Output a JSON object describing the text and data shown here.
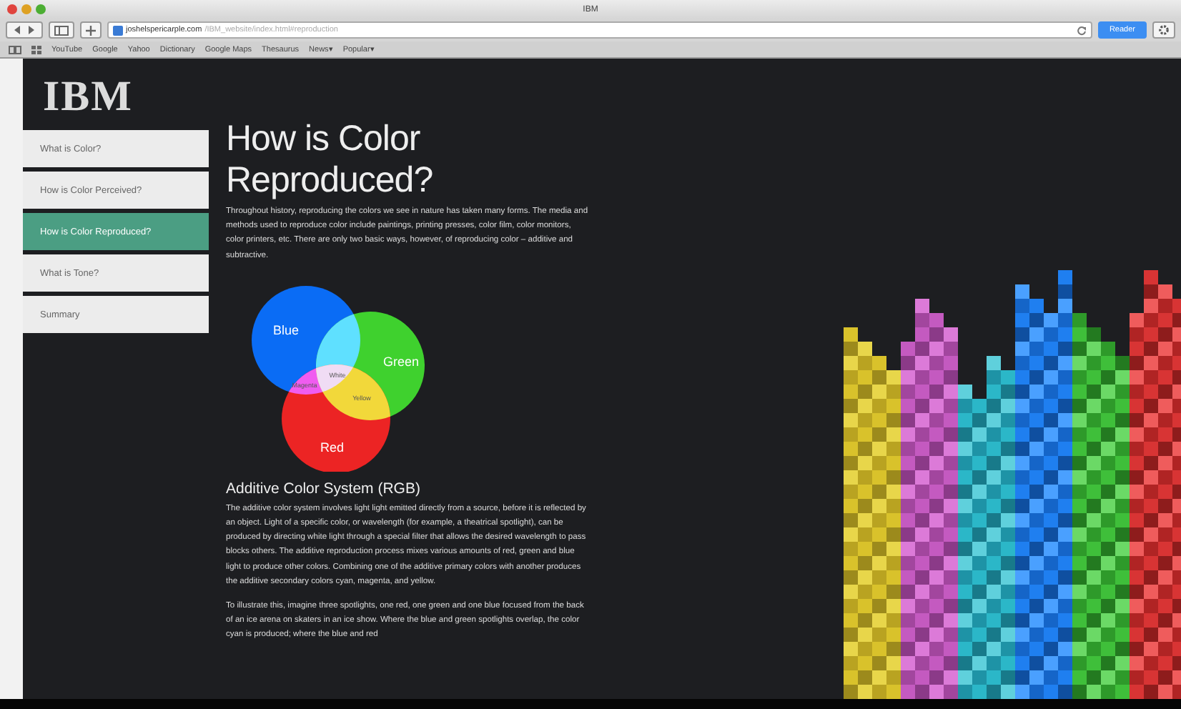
{
  "window": {
    "title": "IBM"
  },
  "toolbar": {
    "url_domain": "joshelspericarple.com",
    "url_path": "/IBM_website/index.html#reproduction",
    "reader": "Reader"
  },
  "bookmarks": [
    {
      "label": "YouTube"
    },
    {
      "label": "Google"
    },
    {
      "label": "Yahoo"
    },
    {
      "label": "Dictionary"
    },
    {
      "label": "Google Maps"
    },
    {
      "label": "Thesaurus"
    },
    {
      "label": "News",
      "caret": "▾"
    },
    {
      "label": "Popular",
      "caret": "▾"
    }
  ],
  "logo": "IBM",
  "sidebar": {
    "items": [
      {
        "label": "What is Color?",
        "selected": false
      },
      {
        "label": "How is Color Perceived?",
        "selected": false
      },
      {
        "label": "How is Color Reproduced?",
        "selected": true
      },
      {
        "label": "What is Tone?",
        "selected": false
      },
      {
        "label": "Summary",
        "selected": false
      }
    ]
  },
  "article": {
    "title": "How is Color Reproduced?",
    "intro": "Throughout history, reproducing the colors we see in nature has taken many forms. The media and methods used to reproduce color include paintings, printing presses, color film, color monitors, color printers, etc. There are only two basic ways, however, of reproducing color – additive and subtractive.",
    "venn": {
      "circles": [
        {
          "label": "Blue",
          "color": "#0a6cf5"
        },
        {
          "label": "Green",
          "color": "#3fd12e"
        },
        {
          "label": "Red",
          "color": "#ec2424"
        }
      ],
      "overlaps": [
        {
          "label": "White",
          "kind": "center"
        },
        {
          "label": "Magenta",
          "kind": "blue-red"
        },
        {
          "label": "Yellow",
          "kind": "green-red"
        }
      ]
    },
    "heading": "Additive Color System (RGB)",
    "paragraphs": [
      "The additive color system involves light light emitted directly from a source, before it is reflected by an object. Light of a specific color, or wavelength (for example, a theatrical spotlight), can be produced by directing white light through a special filter that allows the desired wavelength to pass blocks others. The additive reproduction process mixes various amounts of red, green and blue light to produce other colors. Combining one of the additive primary colors with another produces the additive secondary colors cyan, magenta, and yellow.",
      "To illustrate this, imagine three spotlights, one red, one green and one blue focused from the back of an ice arena on skaters in an ice show. Where the blue and green spotlights overlap, the color cyan is produced; where the blue and red"
    ]
  }
}
